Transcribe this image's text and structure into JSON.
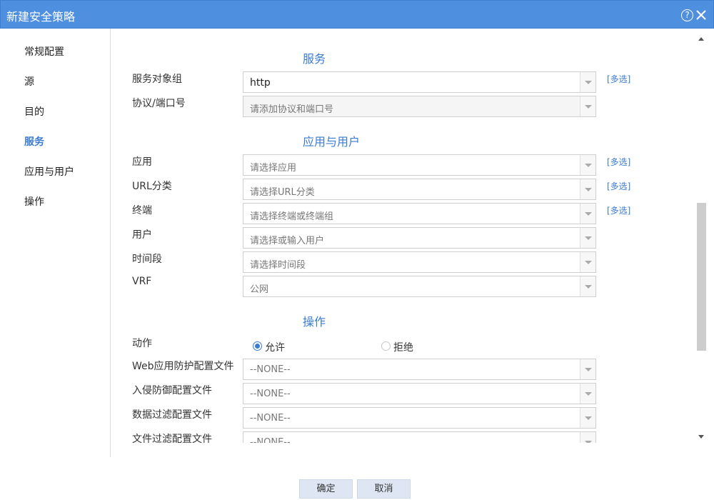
{
  "window": {
    "title": "新建安全策略",
    "help_icon": "?"
  },
  "sidebar": {
    "items": [
      {
        "label": "常规配置"
      },
      {
        "label": "源"
      },
      {
        "label": "目的"
      },
      {
        "label": "服务"
      },
      {
        "label": "应用与用户"
      },
      {
        "label": "操作"
      }
    ],
    "active_index": 3
  },
  "service": {
    "section_title": "服务",
    "object_group_label": "服务对象组",
    "object_group_value": "http",
    "protocol_label": "协议/端口号",
    "protocol_placeholder": "请添加协议和端口号",
    "multi_label": "[多选]"
  },
  "app_user": {
    "section_title": "应用与用户",
    "app_label": "应用",
    "app_placeholder": "请选择应用",
    "url_label": "URL分类",
    "url_placeholder": "请选择URL分类",
    "terminal_label": "终端",
    "terminal_placeholder": "请选择终端或终端组",
    "user_label": "用户",
    "user_placeholder": "请选择或输入用户",
    "time_label": "时间段",
    "time_placeholder": "请选择时间段",
    "vrf_label": "VRF",
    "vrf_value": "公网",
    "multi_label": "[多选]"
  },
  "operation": {
    "section_title": "操作",
    "action_label": "动作",
    "allow_label": "允许",
    "deny_label": "拒绝",
    "allow_checked": true,
    "waf_label": "Web应用防护配置文件",
    "waf_value": "--NONE--",
    "ips_label": "入侵防御配置文件",
    "ips_value": "--NONE--",
    "data_filter_label": "数据过滤配置文件",
    "data_filter_value": "--NONE--",
    "file_filter_label": "文件过滤配置文件",
    "file_filter_value": "--NONE--"
  },
  "footer": {
    "ok_label": "确定",
    "cancel_label": "取消"
  },
  "colors": {
    "titlebar": "#4f8fe0",
    "accent": "#3a7bd5"
  }
}
